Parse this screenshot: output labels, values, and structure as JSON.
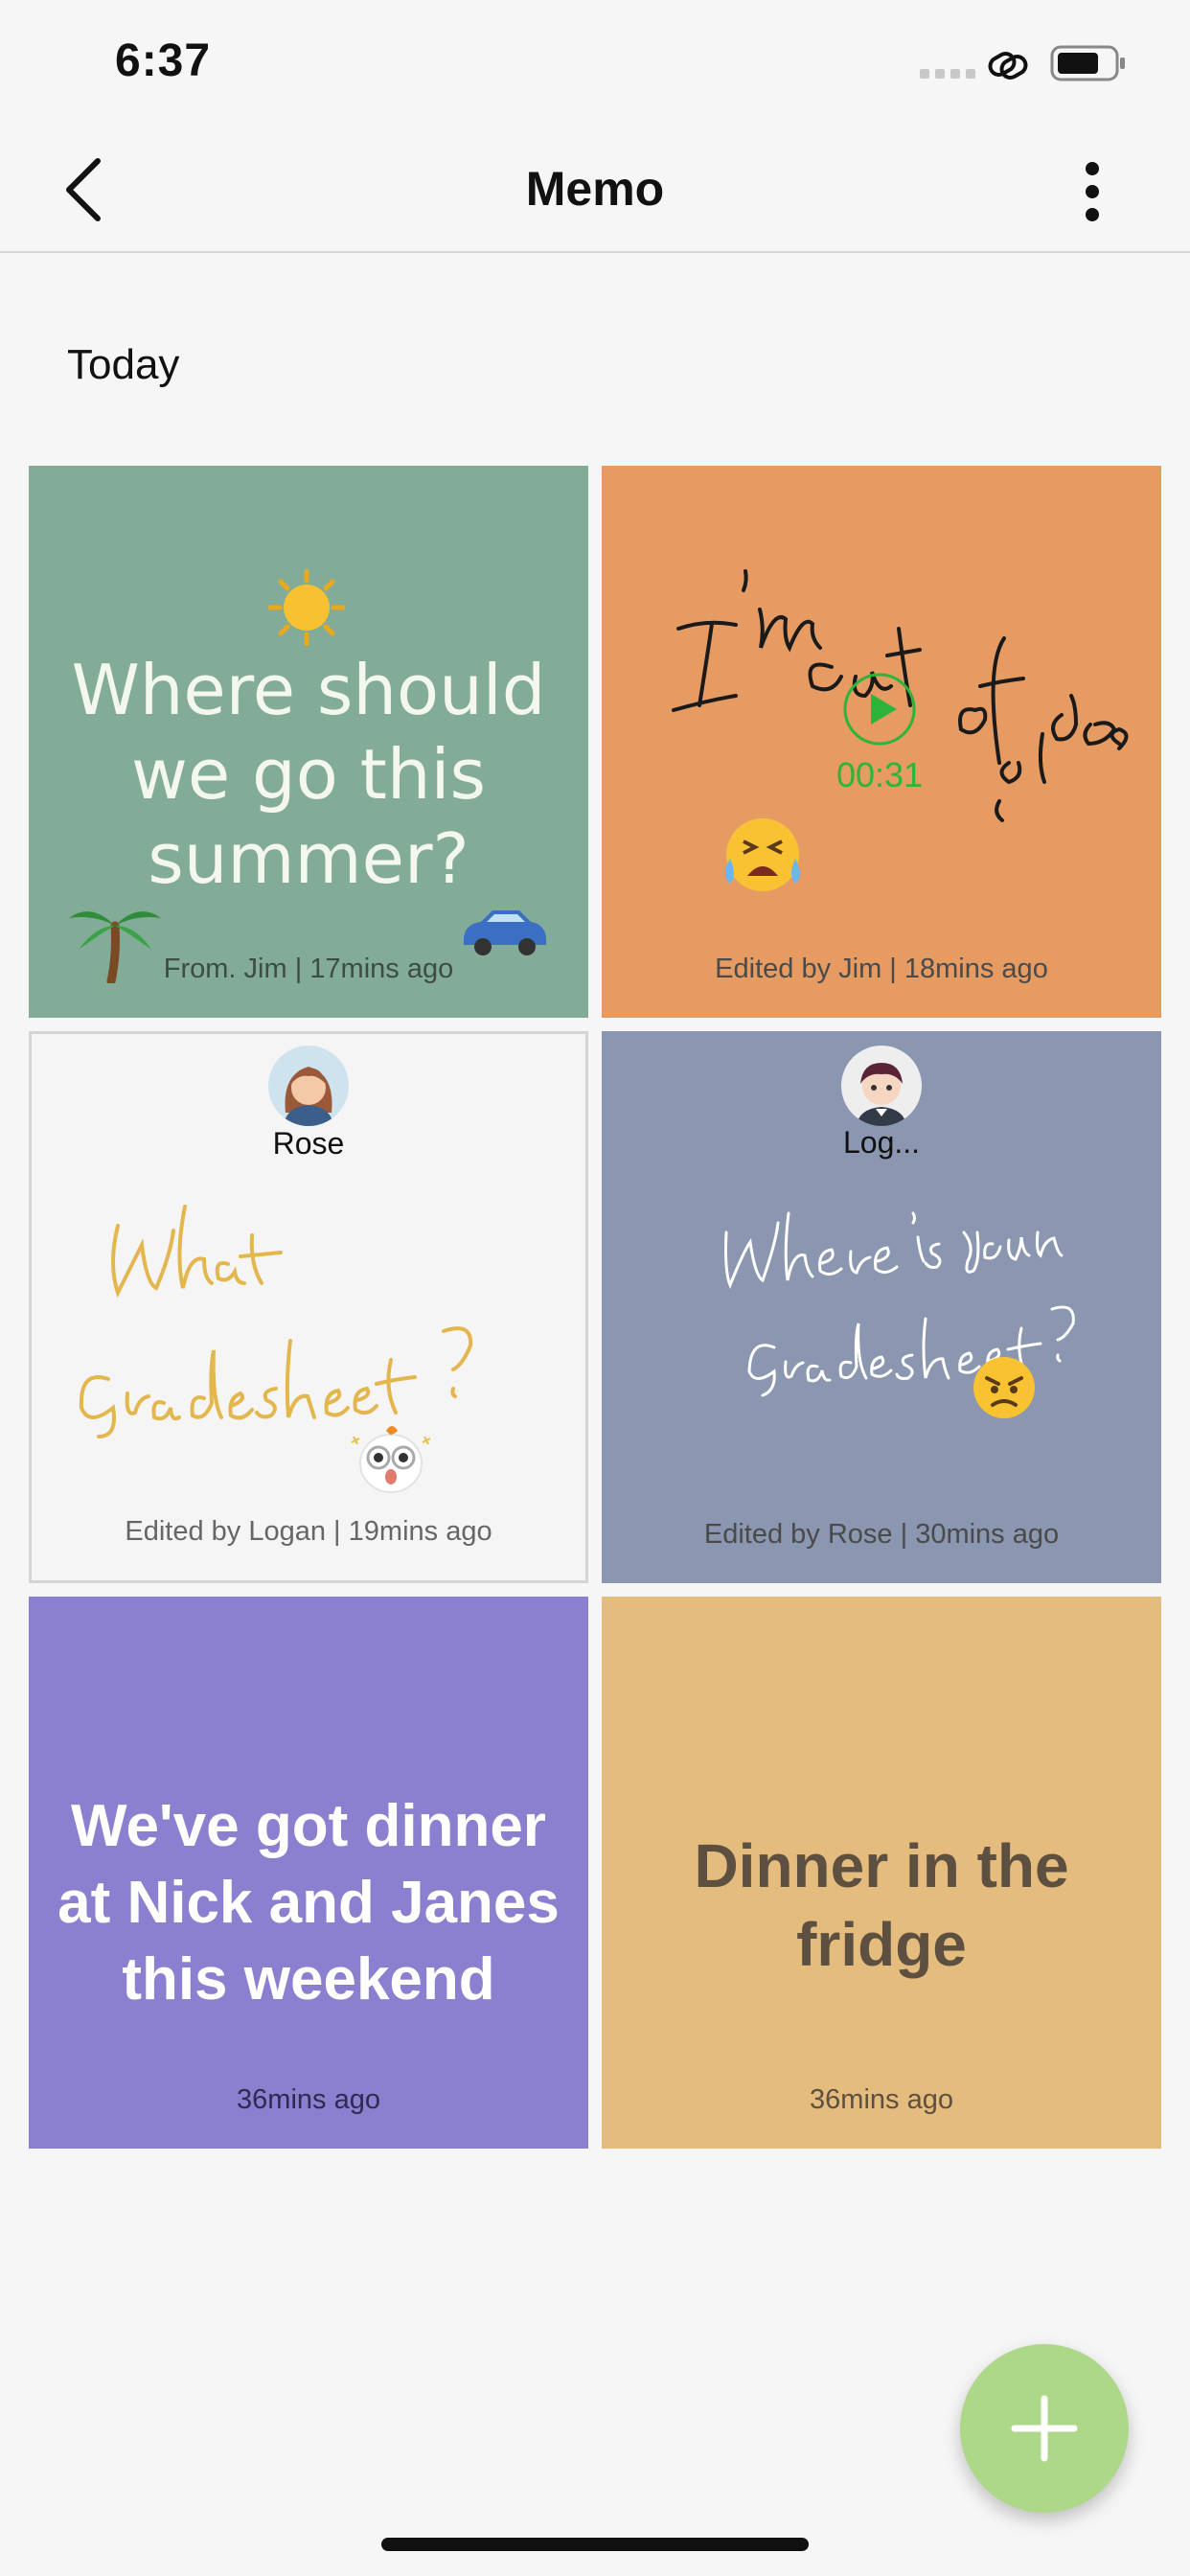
{
  "status_bar": {
    "time": "6:37"
  },
  "header": {
    "title": "Memo"
  },
  "section": {
    "title": "Today"
  },
  "cards": [
    {
      "type": "text",
      "text": "Where should we go this summer?",
      "footer": "From. Jim | 17mins ago",
      "bg": "#83ac98",
      "icons": [
        "sun-icon",
        "palm-tree-icon",
        "car-icon"
      ]
    },
    {
      "type": "voice-handwriting",
      "handwriting": "I'm out of ideas",
      "duration": "00:31",
      "footer": "Edited by Jim | 18mins ago",
      "bg": "#e69b63",
      "icons": [
        "play-icon",
        "crying-face-icon"
      ]
    },
    {
      "type": "handwriting",
      "avatar_name": "Rose",
      "handwriting": "What Gradesheet?",
      "footer": "Edited by Logan | 19mins ago",
      "bg": "#f5f5f5",
      "icons": [
        "owl-sticker-icon"
      ]
    },
    {
      "type": "handwriting",
      "avatar_name": "Log...",
      "handwriting": "Where is your Gradesheet?",
      "footer": "Edited by Rose | 30mins ago",
      "bg": "#8b96b0",
      "icons": [
        "angry-face-icon"
      ]
    },
    {
      "type": "text",
      "text": "We've got dinner at Nick and Janes this weekend",
      "footer": "36mins ago",
      "bg": "#8b80cf"
    },
    {
      "type": "text",
      "text": "Dinner in the fridge",
      "footer": "36mins ago",
      "bg": "#e4bc7d"
    }
  ],
  "fab": {
    "icon": "plus-icon",
    "color": "#acd888"
  }
}
